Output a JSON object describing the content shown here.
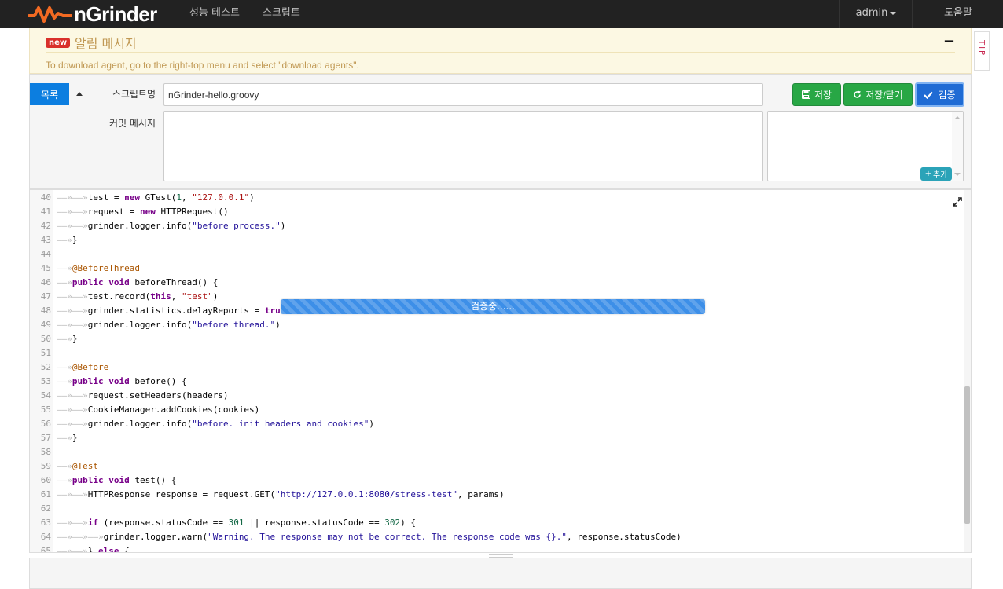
{
  "app": {
    "logo_text": "nGrinder",
    "brand_color": "#f26a22"
  },
  "nav": {
    "items": [
      {
        "label": "성능 테스트"
      },
      {
        "label": "스크립트"
      }
    ],
    "user": "admin",
    "help": "도움말"
  },
  "alert": {
    "badge": "new",
    "title": "알림 메시지",
    "message": "To download agent, go to the right-top menu and select \"download agents\".",
    "minimize_glyph": "−"
  },
  "tip_tab": "TIP",
  "form": {
    "list_button": "목록",
    "script_name_label": "스크립트명",
    "script_name_value": "nGrinder-hello.groovy",
    "commit_label": "커밋 메시지",
    "commit_value": "",
    "save_button": "저장",
    "save_close_button": "저장/닫기",
    "validate_button": "검증",
    "add_button": "추가"
  },
  "progress": {
    "label": "검증중......",
    "value": 1.0
  },
  "editor": {
    "lines": [
      {
        "n": "40",
        "indent": 2,
        "tokens": [
          [
            "p",
            "test = "
          ],
          [
            "kw",
            "new"
          ],
          [
            "p",
            " GTest("
          ],
          [
            "num",
            "1"
          ],
          [
            "p",
            ", "
          ],
          [
            "str",
            "\"127.0.0.1\""
          ],
          [
            "p",
            ")"
          ]
        ]
      },
      {
        "n": "41",
        "indent": 2,
        "tokens": [
          [
            "p",
            "request = "
          ],
          [
            "kw",
            "new"
          ],
          [
            "p",
            " HTTPRequest()"
          ]
        ]
      },
      {
        "n": "42",
        "indent": 2,
        "tokens": [
          [
            "p",
            "grinder.logger.info("
          ],
          [
            "str2",
            "\"before process.\""
          ],
          [
            "p",
            ")"
          ]
        ]
      },
      {
        "n": "43",
        "indent": 1,
        "tokens": [
          [
            "p",
            "}"
          ]
        ]
      },
      {
        "n": "44",
        "indent": 0,
        "tokens": []
      },
      {
        "n": "45",
        "indent": 1,
        "tokens": [
          [
            "ann",
            "@BeforeThread"
          ]
        ]
      },
      {
        "n": "46",
        "indent": 1,
        "tokens": [
          [
            "kw",
            "public"
          ],
          [
            "p",
            " "
          ],
          [
            "kw",
            "void"
          ],
          [
            "p",
            " beforeThread() {"
          ]
        ]
      },
      {
        "n": "47",
        "indent": 2,
        "tokens": [
          [
            "p",
            "test.record("
          ],
          [
            "kw",
            "this"
          ],
          [
            "p",
            ", "
          ],
          [
            "str",
            "\"test\""
          ],
          [
            "p",
            ")"
          ]
        ]
      },
      {
        "n": "48",
        "indent": 2,
        "tokens": [
          [
            "p",
            "grinder.statistics.delayReports = "
          ],
          [
            "kw",
            "true"
          ]
        ]
      },
      {
        "n": "49",
        "indent": 2,
        "tokens": [
          [
            "p",
            "grinder.logger.info("
          ],
          [
            "str2",
            "\"before thread.\""
          ],
          [
            "p",
            ")"
          ]
        ]
      },
      {
        "n": "50",
        "indent": 1,
        "tokens": [
          [
            "p",
            "}"
          ]
        ]
      },
      {
        "n": "51",
        "indent": 0,
        "tokens": []
      },
      {
        "n": "52",
        "indent": 1,
        "tokens": [
          [
            "ann",
            "@Before"
          ]
        ]
      },
      {
        "n": "53",
        "indent": 1,
        "tokens": [
          [
            "kw",
            "public"
          ],
          [
            "p",
            " "
          ],
          [
            "kw",
            "void"
          ],
          [
            "p",
            " before() {"
          ]
        ]
      },
      {
        "n": "54",
        "indent": 2,
        "tokens": [
          [
            "p",
            "request.setHeaders(headers)"
          ]
        ]
      },
      {
        "n": "55",
        "indent": 2,
        "tokens": [
          [
            "p",
            "CookieManager.addCookies(cookies)"
          ]
        ]
      },
      {
        "n": "56",
        "indent": 2,
        "tokens": [
          [
            "p",
            "grinder.logger.info("
          ],
          [
            "str2",
            "\"before. init headers and cookies\""
          ],
          [
            "p",
            ")"
          ]
        ]
      },
      {
        "n": "57",
        "indent": 1,
        "tokens": [
          [
            "p",
            "}"
          ]
        ]
      },
      {
        "n": "58",
        "indent": 0,
        "tokens": []
      },
      {
        "n": "59",
        "indent": 1,
        "tokens": [
          [
            "ann",
            "@Test"
          ]
        ]
      },
      {
        "n": "60",
        "indent": 1,
        "tokens": [
          [
            "kw",
            "public"
          ],
          [
            "p",
            " "
          ],
          [
            "kw",
            "void"
          ],
          [
            "p",
            " test() {"
          ]
        ]
      },
      {
        "n": "61",
        "indent": 2,
        "tokens": [
          [
            "p",
            "HTTPResponse response = request.GET("
          ],
          [
            "str2",
            "\"http://127.0.0.1:8080/stress-test\""
          ],
          [
            "p",
            ", params)"
          ]
        ]
      },
      {
        "n": "62",
        "indent": 0,
        "tokens": []
      },
      {
        "n": "63",
        "indent": 2,
        "tokens": [
          [
            "kw",
            "if"
          ],
          [
            "p",
            " (response.statusCode == "
          ],
          [
            "num",
            "301"
          ],
          [
            "p",
            " || response.statusCode == "
          ],
          [
            "num",
            "302"
          ],
          [
            "p",
            ") {"
          ]
        ]
      },
      {
        "n": "64",
        "indent": 3,
        "tokens": [
          [
            "p",
            "grinder.logger.warn("
          ],
          [
            "str2",
            "\"Warning. The response may not be correct. The response code was {}.\""
          ],
          [
            "p",
            ", response.statusCode)"
          ]
        ]
      },
      {
        "n": "65",
        "indent": 2,
        "tokens": [
          [
            "p",
            "} "
          ],
          [
            "kw",
            "else"
          ],
          [
            "p",
            " {"
          ]
        ]
      }
    ]
  }
}
